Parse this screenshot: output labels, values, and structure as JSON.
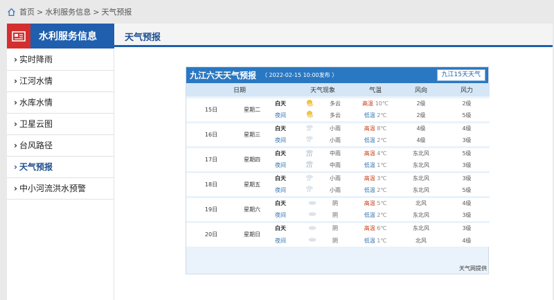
{
  "breadcrumb": {
    "home": "首页",
    "section": "水利服务信息",
    "current": "天气预报",
    "sep": ">"
  },
  "sidebar": {
    "title": "水利服务信息",
    "items": [
      {
        "label": "实时降雨"
      },
      {
        "label": "江河水情"
      },
      {
        "label": "水库水情"
      },
      {
        "label": "卫星云图"
      },
      {
        "label": "台风路径"
      },
      {
        "label": "天气预报",
        "active": true
      },
      {
        "label": "中小河流洪水预警"
      }
    ]
  },
  "tab_title": "天气预报",
  "forecast": {
    "title": "九江六天天气预报",
    "published": "（ 2022-02-15 10:00发布 ）",
    "button_15": "九江15天天气",
    "headers": [
      "日期",
      "天气现象",
      "气温",
      "风向",
      "风力"
    ],
    "day_label": "白天",
    "night_label": "夜间",
    "high_label": "高温",
    "low_label": "低温",
    "provider": "天气网提供",
    "days": [
      {
        "date": "15日",
        "week": "星期二",
        "weekend": false,
        "day": {
          "icon": "sun-cloud-icon",
          "weather": "多云",
          "temp": "10℃",
          "wind_dir": "2级",
          "wind_force": "2级"
        },
        "night": {
          "icon": "sun-cloud-icon",
          "weather": "多云",
          "temp": "2℃",
          "wind_dir": "2级",
          "wind_force": "5级"
        }
      },
      {
        "date": "16日",
        "week": "星期三",
        "weekend": false,
        "day": {
          "icon": "rain-cloud-icon",
          "weather": "小雨",
          "temp": "8℃",
          "wind_dir": "4级",
          "wind_force": "4级"
        },
        "night": {
          "icon": "rain-cloud-icon",
          "weather": "小雨",
          "temp": "2℃",
          "wind_dir": "4级",
          "wind_force": "3级"
        }
      },
      {
        "date": "17日",
        "week": "星期四",
        "weekend": false,
        "day": {
          "icon": "heavy-rain-icon",
          "weather": "中雨",
          "temp": "4℃",
          "wind_dir": "东北风",
          "wind_force": "5级"
        },
        "night": {
          "icon": "heavy-rain-icon",
          "weather": "中雨",
          "temp": "1℃",
          "wind_dir": "东北风",
          "wind_force": "3级"
        }
      },
      {
        "date": "18日",
        "week": "星期五",
        "weekend": false,
        "day": {
          "icon": "rain-cloud-icon",
          "weather": "小雨",
          "temp": "3℃",
          "wind_dir": "东北风",
          "wind_force": "3级"
        },
        "night": {
          "icon": "rain-cloud-icon",
          "weather": "小雨",
          "temp": "2℃",
          "wind_dir": "东北风",
          "wind_force": "5级"
        }
      },
      {
        "date": "19日",
        "week": "星期六",
        "weekend": true,
        "day": {
          "icon": "overcast-icon",
          "weather": "阴",
          "temp": "5℃",
          "wind_dir": "北风",
          "wind_force": "4级"
        },
        "night": {
          "icon": "overcast-icon",
          "weather": "阴",
          "temp": "2℃",
          "wind_dir": "东北风",
          "wind_force": "3级"
        }
      },
      {
        "date": "20日",
        "week": "星期日",
        "weekend": true,
        "day": {
          "icon": "overcast-icon",
          "weather": "阴",
          "temp": "6℃",
          "wind_dir": "东北风",
          "wind_force": "3级"
        },
        "night": {
          "icon": "overcast-icon",
          "weather": "阴",
          "temp": "1℃",
          "wind_dir": "北风",
          "wind_force": "4级"
        }
      }
    ]
  },
  "colors": {
    "brand_blue": "#1f5fae",
    "accent_red": "#d32f2f",
    "high_temp": "#c8370f",
    "low_temp": "#2a6fb0",
    "weekend": "#2e8a1e"
  }
}
